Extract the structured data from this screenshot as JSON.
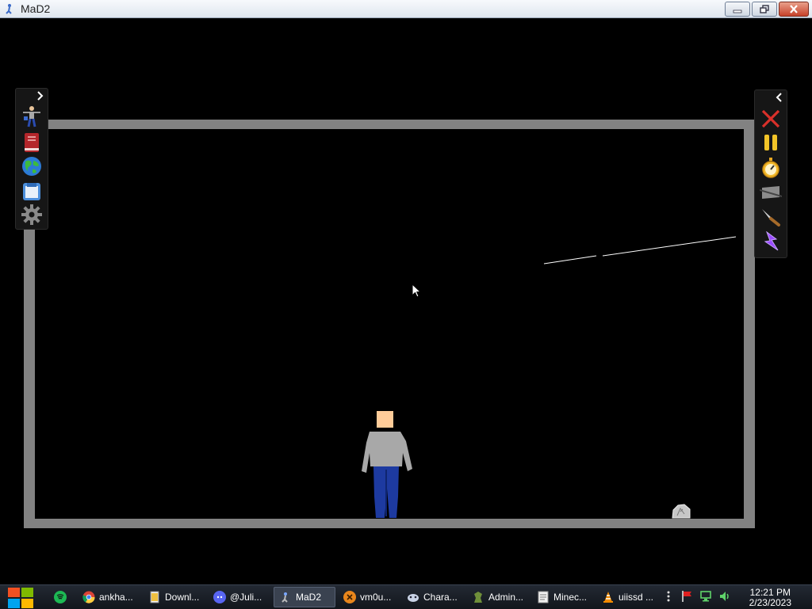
{
  "window": {
    "title": "MaD2"
  },
  "taskbar": {
    "items": [
      {
        "label": "ankha..."
      },
      {
        "label": "Downl..."
      },
      {
        "label": "@Juli..."
      },
      {
        "label": "MaD2"
      },
      {
        "label": "vm0u..."
      },
      {
        "label": "Chara..."
      },
      {
        "label": "Admin..."
      },
      {
        "label": "Minec..."
      },
      {
        "label": "uiissd ..."
      }
    ],
    "time": "12:21 PM",
    "date": "2/23/2023"
  },
  "colors": {
    "arena_wall": "#828282",
    "background": "#000000",
    "shirt": "#a8a8a8",
    "pants": "#1d3aa0",
    "skin": "#ffcc99",
    "close_red": "#d9302a",
    "lightning": "#9a4cff"
  },
  "icons": {
    "left_panel": [
      "ragdoll-icon",
      "book-icon",
      "globe-icon",
      "save-icon",
      "gear-icon"
    ],
    "right_panel": [
      "close-x-icon",
      "pause-icon",
      "stopwatch-icon",
      "slow-motion-icon",
      "knife-icon",
      "lightning-icon"
    ]
  }
}
